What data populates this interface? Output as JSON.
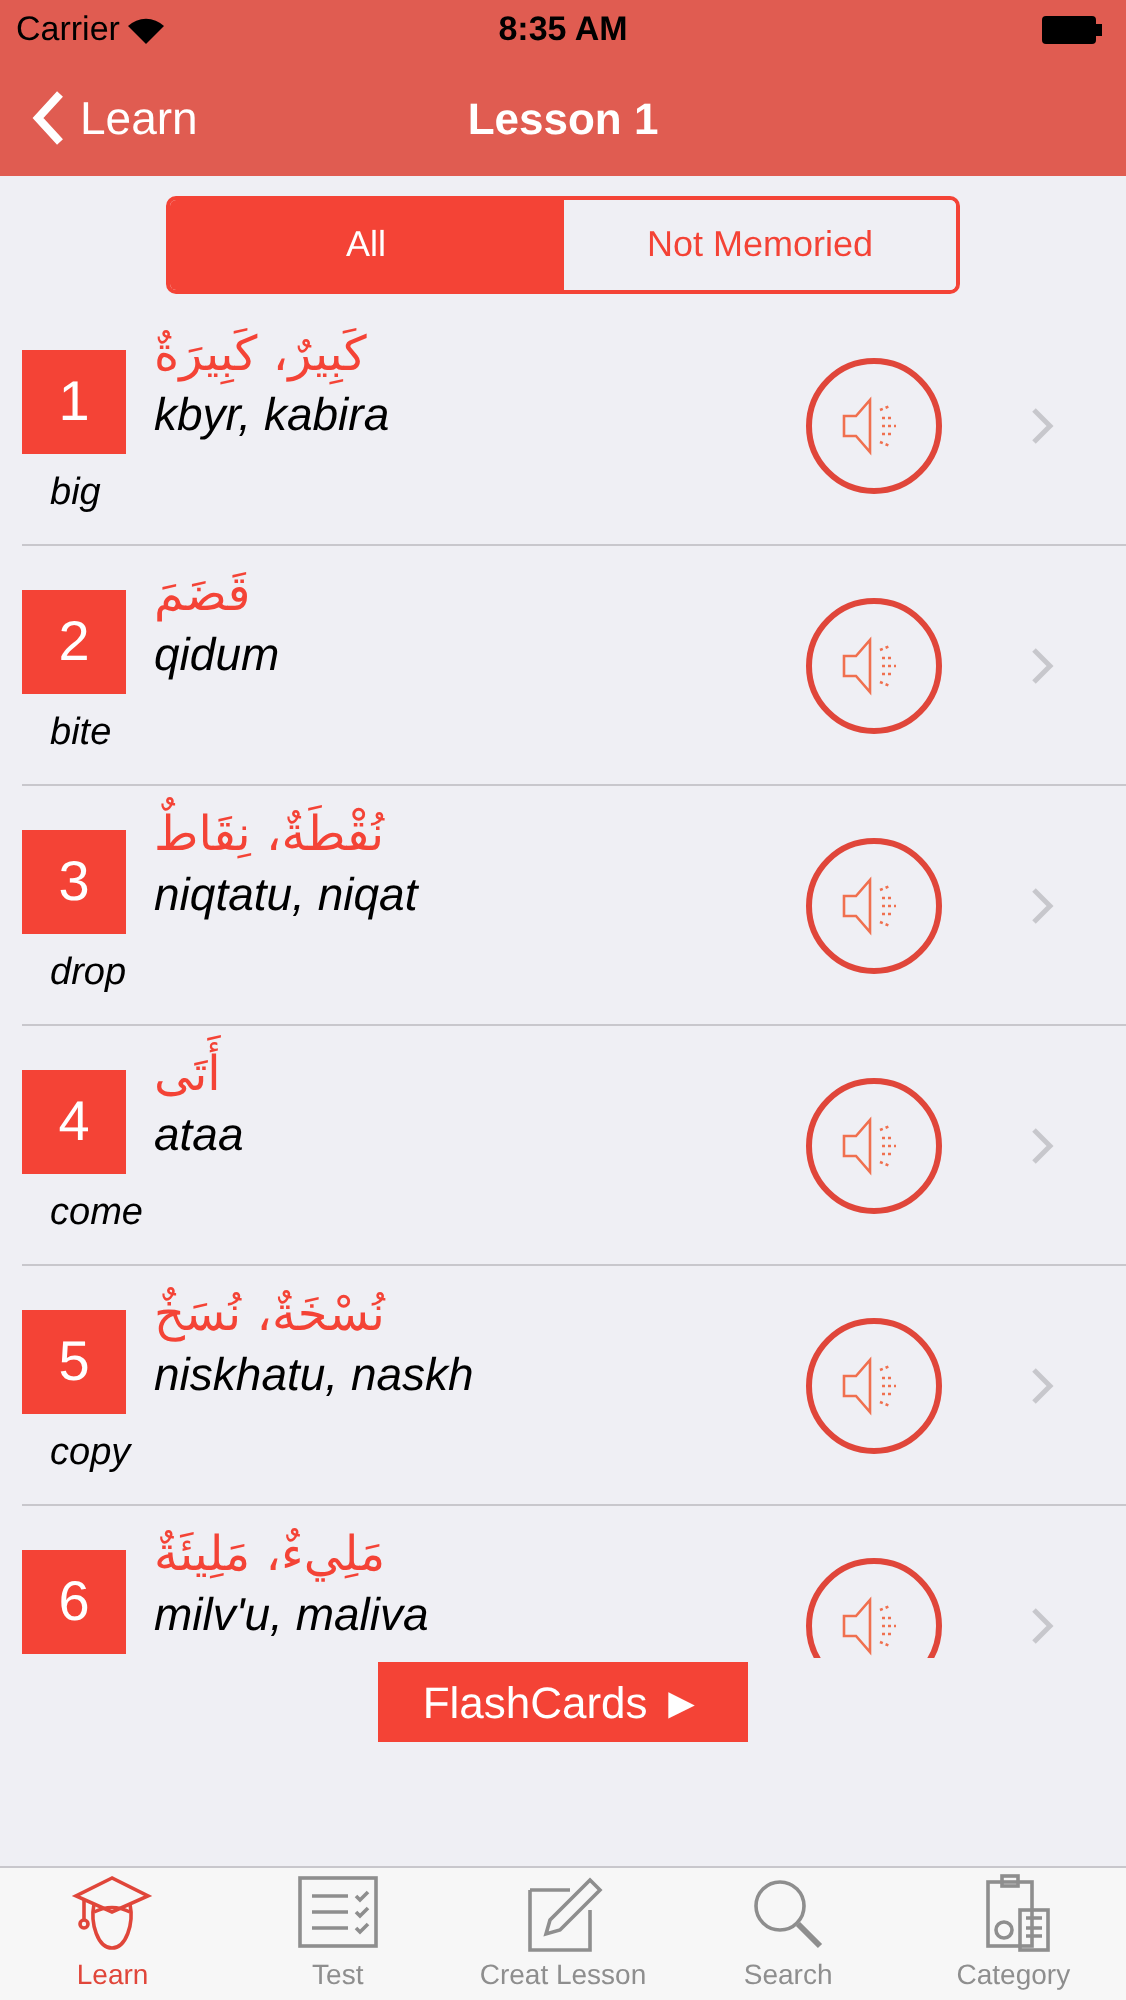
{
  "status_bar": {
    "carrier": "Carrier",
    "time": "8:35 AM"
  },
  "nav": {
    "back": "Learn",
    "title": "Lesson 1"
  },
  "segments": [
    {
      "label": "All",
      "selected": true
    },
    {
      "label": "Not Memoried",
      "selected": false
    }
  ],
  "words": [
    {
      "number": "1",
      "arabic": "كَبِيرٌ، كَبِيرَةٌ",
      "transliteration": "kbyr, kabira",
      "meaning": "big"
    },
    {
      "number": "2",
      "arabic": "قَضَمَ",
      "transliteration": "qidum",
      "meaning": "bite"
    },
    {
      "number": "3",
      "arabic": "نُقْطَةٌ، نِقَاطٌ",
      "transliteration": "niqtatu, niqat",
      "meaning": "drop"
    },
    {
      "number": "4",
      "arabic": "أَتَى",
      "transliteration": "ataa",
      "meaning": "come"
    },
    {
      "number": "5",
      "arabic": "نُسْخَةٌ، نُسَخٌ",
      "transliteration": "niskhatu, naskh",
      "meaning": "copy"
    },
    {
      "number": "6",
      "arabic": "مَلِيءٌ، مَلِيئَةٌ",
      "transliteration": "milv'u, maliva"
    }
  ],
  "flashcards_button": "FlashCards ►",
  "tab_bar": [
    {
      "label": "Learn",
      "kind": "learn",
      "selected": true
    },
    {
      "label": "Test",
      "kind": "test",
      "selected": false
    },
    {
      "label": "Creat Lesson",
      "kind": "create",
      "selected": false
    },
    {
      "label": "Search",
      "kind": "search",
      "selected": false
    },
    {
      "label": "Category",
      "kind": "category",
      "selected": false
    }
  ]
}
